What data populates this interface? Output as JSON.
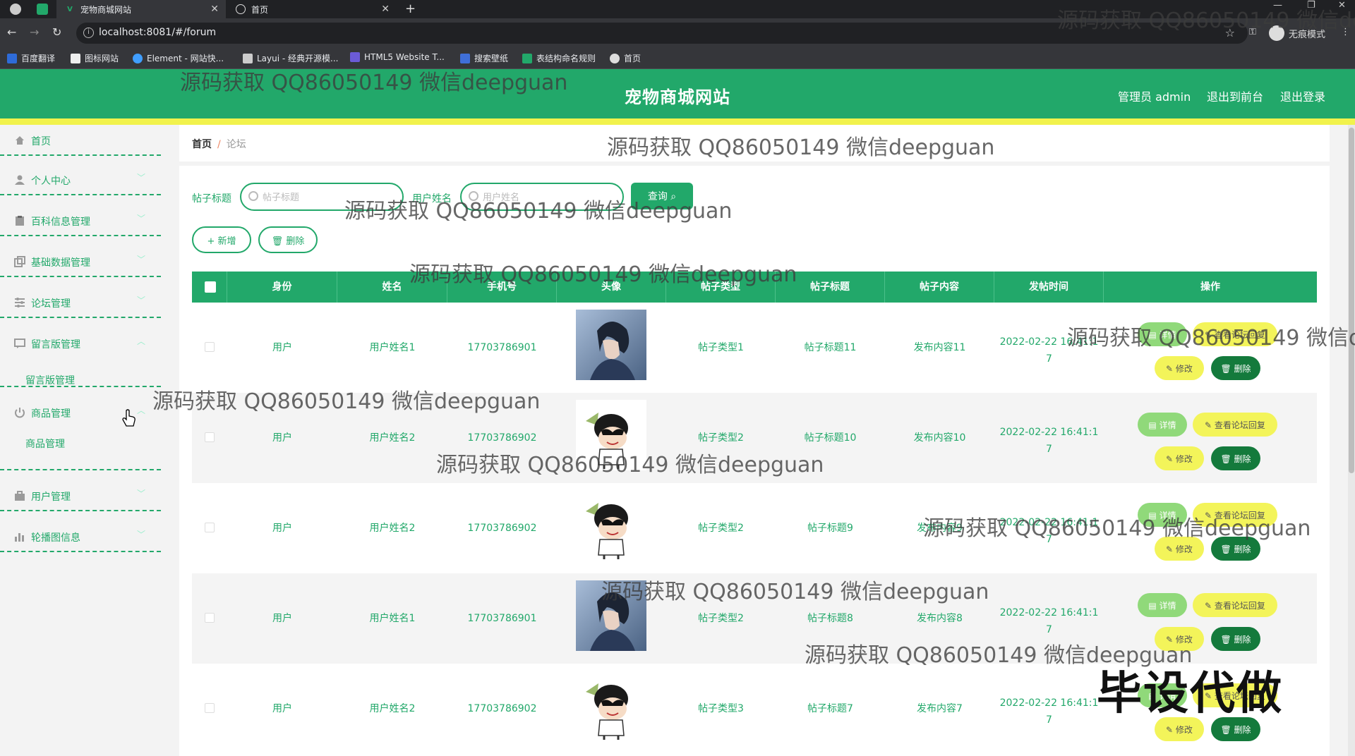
{
  "browser": {
    "tabs": [
      {
        "title": "宠物商城网站",
        "active": true
      },
      {
        "title": "首页",
        "active": false
      }
    ],
    "url": "localhost:8081/#/forum",
    "incognito_label": "无痕模式",
    "bookmarks": [
      {
        "label": "百度翻译",
        "color": "#2e6bd8"
      },
      {
        "label": "图标网站",
        "color": "#eeeeee"
      },
      {
        "label": "Element - 网站快...",
        "color": "#409eff"
      },
      {
        "label": "Layui - 经典开源模...",
        "color": "#cccccc"
      },
      {
        "label": "HTML5 Website T...",
        "color": "#6b5bd6"
      },
      {
        "label": "搜索壁纸",
        "color": "#3f6fd8"
      },
      {
        "label": "表结构命名规则",
        "color": "#22a86a"
      },
      {
        "label": "首页",
        "color": "#dddddd"
      }
    ]
  },
  "header": {
    "title": "宠物商城网站",
    "admin": "管理员 admin",
    "to_front": "退出到前台",
    "logout": "退出登录"
  },
  "sidebar": {
    "items": [
      {
        "label": "首页",
        "icon": "home-icon"
      },
      {
        "label": "个人中心",
        "icon": "user-icon"
      },
      {
        "label": "百科信息管理",
        "icon": "clipboard-icon"
      },
      {
        "label": "基础数据管理",
        "icon": "copy-icon"
      },
      {
        "label": "论坛管理",
        "icon": "sliders-icon"
      },
      {
        "label": "留言版管理",
        "icon": "message-icon"
      },
      {
        "label": "商品管理",
        "icon": "power-icon"
      },
      {
        "label": "用户管理",
        "icon": "briefcase-icon"
      },
      {
        "label": "轮播图信息",
        "icon": "bar-chart-icon"
      }
    ],
    "sub_liuyan": "留言版管理",
    "sub_shangpin": "商品管理"
  },
  "breadcrumb": {
    "home": "首页",
    "sep": "/",
    "current": "论坛"
  },
  "filters": {
    "title_label": "帖子标题",
    "title_placeholder": "帖子标题",
    "user_label": "用户姓名",
    "user_placeholder": "用户姓名",
    "search_btn": "查询"
  },
  "actions": {
    "add": "+ 新增",
    "delete": "删除"
  },
  "table": {
    "headers": [
      "身份",
      "姓名",
      "手机号",
      "头像",
      "帖子类型",
      "帖子标题",
      "帖子内容",
      "发帖时间",
      "操作"
    ],
    "rows": [
      {
        "role": "用户",
        "name": "用户姓名1",
        "phone": "17703786901",
        "avatar": "boy",
        "type": "帖子类型1",
        "title": "帖子标题11",
        "content": "发布内容11",
        "time1": "2022-02-22 16:41:1",
        "time2": "7"
      },
      {
        "role": "用户",
        "name": "用户姓名2",
        "phone": "17703786902",
        "avatar": "cartoon",
        "type": "帖子类型2",
        "title": "帖子标题10",
        "content": "发布内容10",
        "time1": "2022-02-22 16:41:1",
        "time2": "7"
      },
      {
        "role": "用户",
        "name": "用户姓名2",
        "phone": "17703786902",
        "avatar": "cartoon",
        "type": "帖子类型2",
        "title": "帖子标题9",
        "content": "发布内容9",
        "time1": "2022-02-22 16:41:1",
        "time2": "7"
      },
      {
        "role": "用户",
        "name": "用户姓名1",
        "phone": "17703786901",
        "avatar": "boy",
        "type": "帖子类型2",
        "title": "帖子标题8",
        "content": "发布内容8",
        "time1": "2022-02-22 16:41:1",
        "time2": "7"
      },
      {
        "role": "用户",
        "name": "用户姓名2",
        "phone": "17703786902",
        "avatar": "cartoon",
        "type": "帖子类型3",
        "title": "帖子标题7",
        "content": "发布内容7",
        "time1": "2022-02-22 16:41:1",
        "time2": "7"
      }
    ],
    "op_detail": "详情",
    "op_reply": "查看论坛回复",
    "op_edit": "修改",
    "op_delete": "删除"
  },
  "overlay": {
    "watermark": "源码获取 QQ86050149 微信deepguan",
    "stamp": "毕设代做"
  },
  "colors": {
    "primary": "#22a86a",
    "accent_yellow": "#f3f45a",
    "dark_green": "#147a3c"
  }
}
